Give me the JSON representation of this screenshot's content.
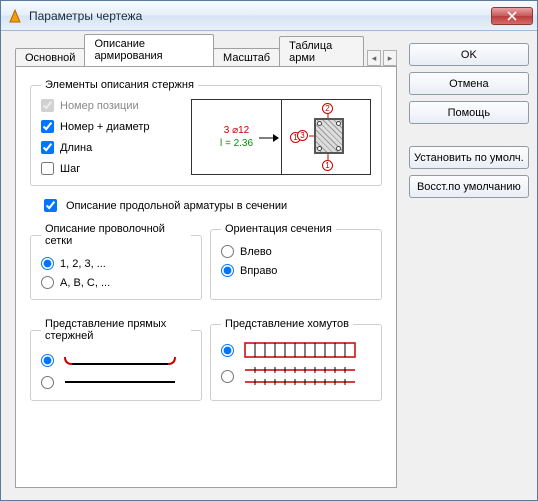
{
  "window": {
    "title": "Параметры чертежа"
  },
  "tabs": {
    "t0": "Основной",
    "t1": "Описание армирования",
    "t2": "Масштаб",
    "t3": "Таблица арми"
  },
  "buttons": {
    "ok": "OK",
    "cancel": "Отмена",
    "help": "Помощь",
    "set_default": "Установить по умолч.",
    "restore_default": "Восст.по умолчанию"
  },
  "group_bar": {
    "legend": "Элементы описания стержня",
    "cb_position": "Номер позиции",
    "cb_num_diam": "Номер + диаметр",
    "cb_length": "Длина",
    "cb_step": "Шаг",
    "preview_text1": "3 ⌀12",
    "preview_text2": "l = 2.36"
  },
  "cb_long": "Описание продольной арматуры в сечении",
  "group_mesh": {
    "legend": "Описание проволочной сетки",
    "opt1": "1, 2, 3, ...",
    "opt2": "A, B, C, ..."
  },
  "group_orient": {
    "legend": "Ориентация сечения",
    "opt1": "Влево",
    "opt2": "Вправо"
  },
  "group_straight": {
    "legend": "Представление прямых стержней"
  },
  "group_stirrup": {
    "legend": "Представление хомутов"
  }
}
